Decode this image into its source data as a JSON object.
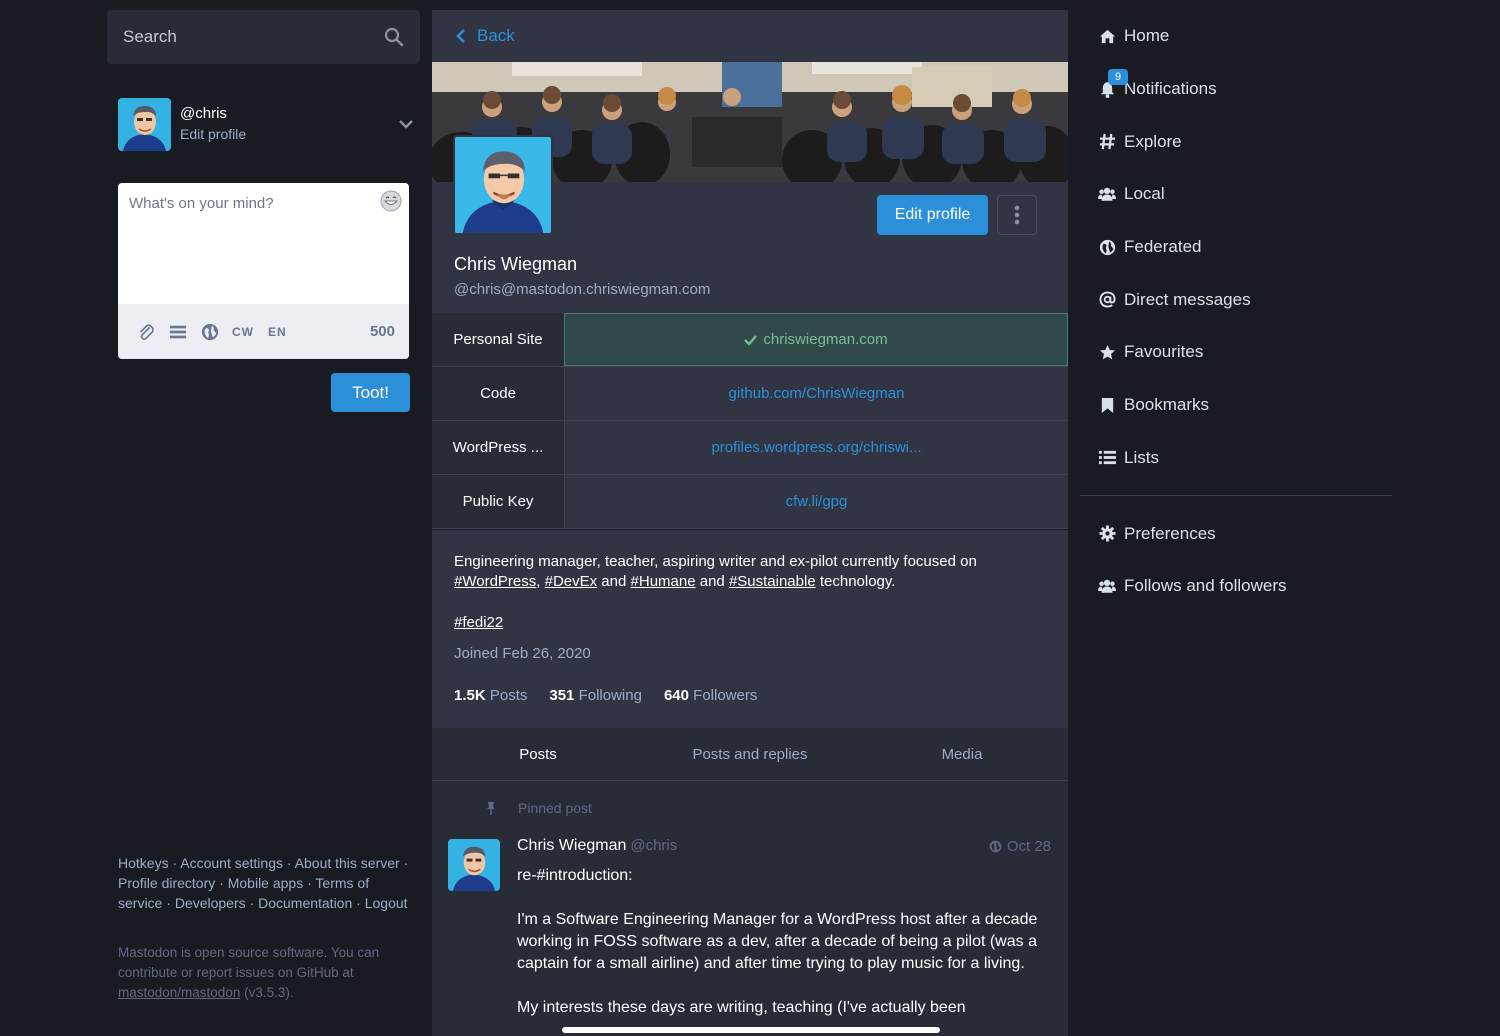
{
  "search": {
    "placeholder": "Search"
  },
  "account": {
    "handle": "@chris",
    "edit": "Edit profile"
  },
  "compose": {
    "placeholder": "What's on your mind?",
    "cw": "CW",
    "lang": "EN",
    "count": "500",
    "toot": "Toot!"
  },
  "footer": {
    "links": [
      "Hotkeys",
      "Account settings",
      "About this server",
      "Profile directory",
      "Mobile apps",
      "Terms of service",
      "Developers",
      "Documentation",
      "Logout"
    ],
    "about_1": "Mastodon is open source software. You can contribute or report issues on GitHub at ",
    "about_link": "mastodon/mastodon",
    "about_2": " (v3.5.3)."
  },
  "profile": {
    "back": "Back",
    "edit_button": "Edit profile",
    "display_name": "Chris Wiegman",
    "acct": "@chris@mastodon.chriswiegman.com",
    "fields": [
      {
        "name": "Personal Site",
        "value": "chriswiegman.com",
        "verified": true
      },
      {
        "name": "Code",
        "value": "github.com/ChrisWiegman",
        "verified": false
      },
      {
        "name": "WordPress ...",
        "value": "profiles.wordpress.org/chriswi...",
        "verified": false
      },
      {
        "name": "Public Key",
        "value": "cfw.li/gpg",
        "verified": false
      }
    ],
    "bio_1": "Engineering manager, teacher, aspiring writer and ex-pilot currently focused on ",
    "bio_tags": [
      "#WordPress",
      "#DevEx",
      "#Humane",
      "#Sustainable"
    ],
    "bio_sep_1": ", ",
    "bio_sep_2": " and ",
    "bio_sep_3": " and ",
    "bio_end": " technology.",
    "tag_line": "#fedi22",
    "joined": "Joined Feb 26, 2020",
    "stats": {
      "posts_count": "1.5K",
      "posts_label": "Posts",
      "following_count": "351",
      "following_label": "Following",
      "followers_count": "640",
      "followers_label": "Followers"
    },
    "tabs": [
      "Posts",
      "Posts and replies",
      "Media"
    ]
  },
  "status": {
    "pinned_label": "Pinned post",
    "name": "Chris Wiegman",
    "handle": "@chris",
    "date": "Oct 28",
    "para_1": "re-#introduction:",
    "para_2": "I'm a Software Engineering Manager for a WordPress host after a decade working in FOSS software as a dev, after a decade of being a pilot (was a captain for a small airline) and after time trying to play music for a living.",
    "para_3": "My interests these days are writing, teaching (I've actually been"
  },
  "nav": {
    "items": [
      "Home",
      "Notifications",
      "Explore",
      "Local",
      "Federated",
      "Direct messages",
      "Favourites",
      "Bookmarks",
      "Lists"
    ],
    "notifications_badge": "9",
    "secondary": [
      "Preferences",
      "Follows and followers"
    ]
  },
  "colors": {
    "accent": "#2b90d9",
    "verified": "#79bd9a",
    "bg": "#191b22",
    "panel": "#313543"
  }
}
